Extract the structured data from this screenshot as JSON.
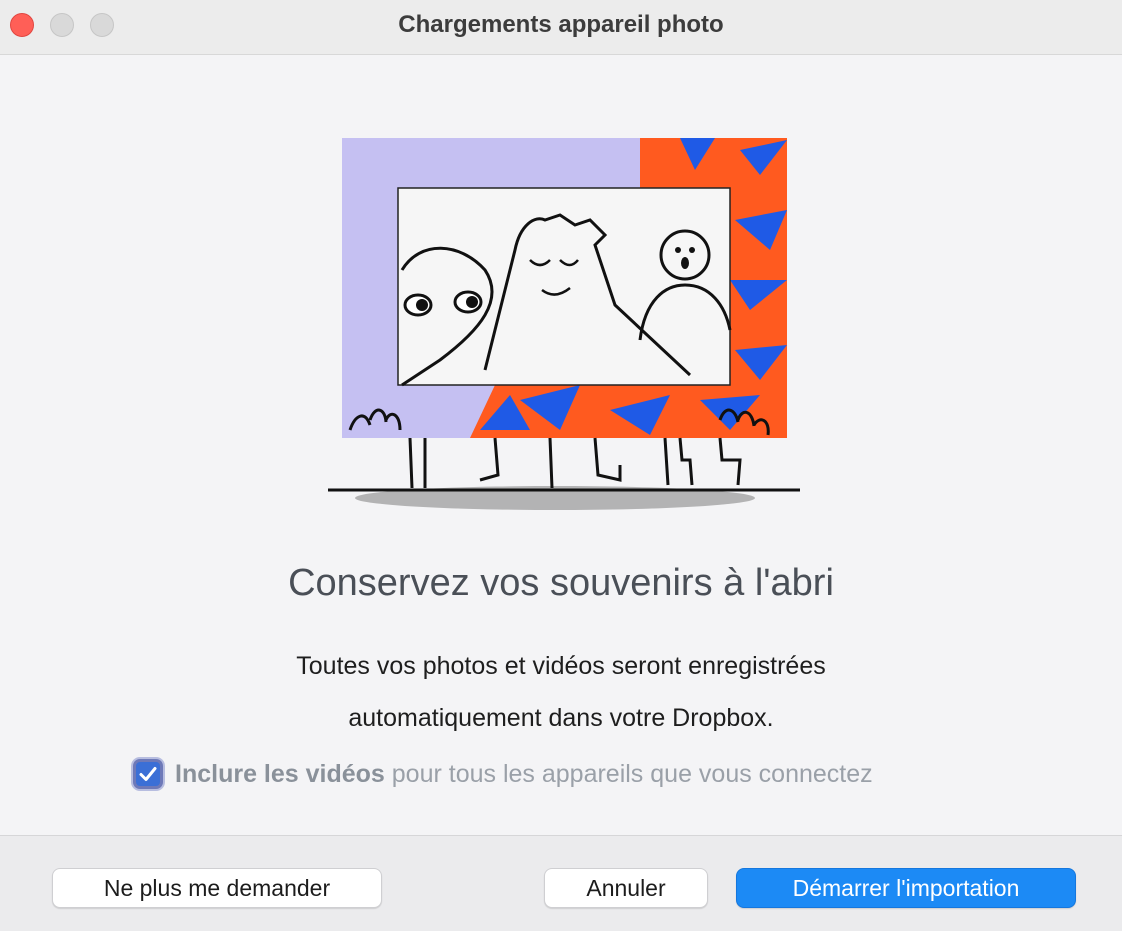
{
  "window": {
    "title": "Chargements appareil photo"
  },
  "main": {
    "headline": "Conservez vos souvenirs à l'abri",
    "description_line1": "Toutes vos photos et vidéos seront enregistrées",
    "description_line2": "automatiquement dans votre Dropbox.",
    "include_checkbox": {
      "checked": true,
      "label_bold": "Inclure les vidéos",
      "label_rest": " pour tous les appareils que vous connectez"
    }
  },
  "footer": {
    "never_ask_label": "Ne plus me demander",
    "cancel_label": "Annuler",
    "start_label": "Démarrer l'importation"
  },
  "colors": {
    "accent": "#1c8af5",
    "close": "#ff5f57",
    "frame_lavender": "#c5c0f2",
    "frame_orange": "#ff5a1f",
    "frame_blue": "#1f5ae6"
  }
}
